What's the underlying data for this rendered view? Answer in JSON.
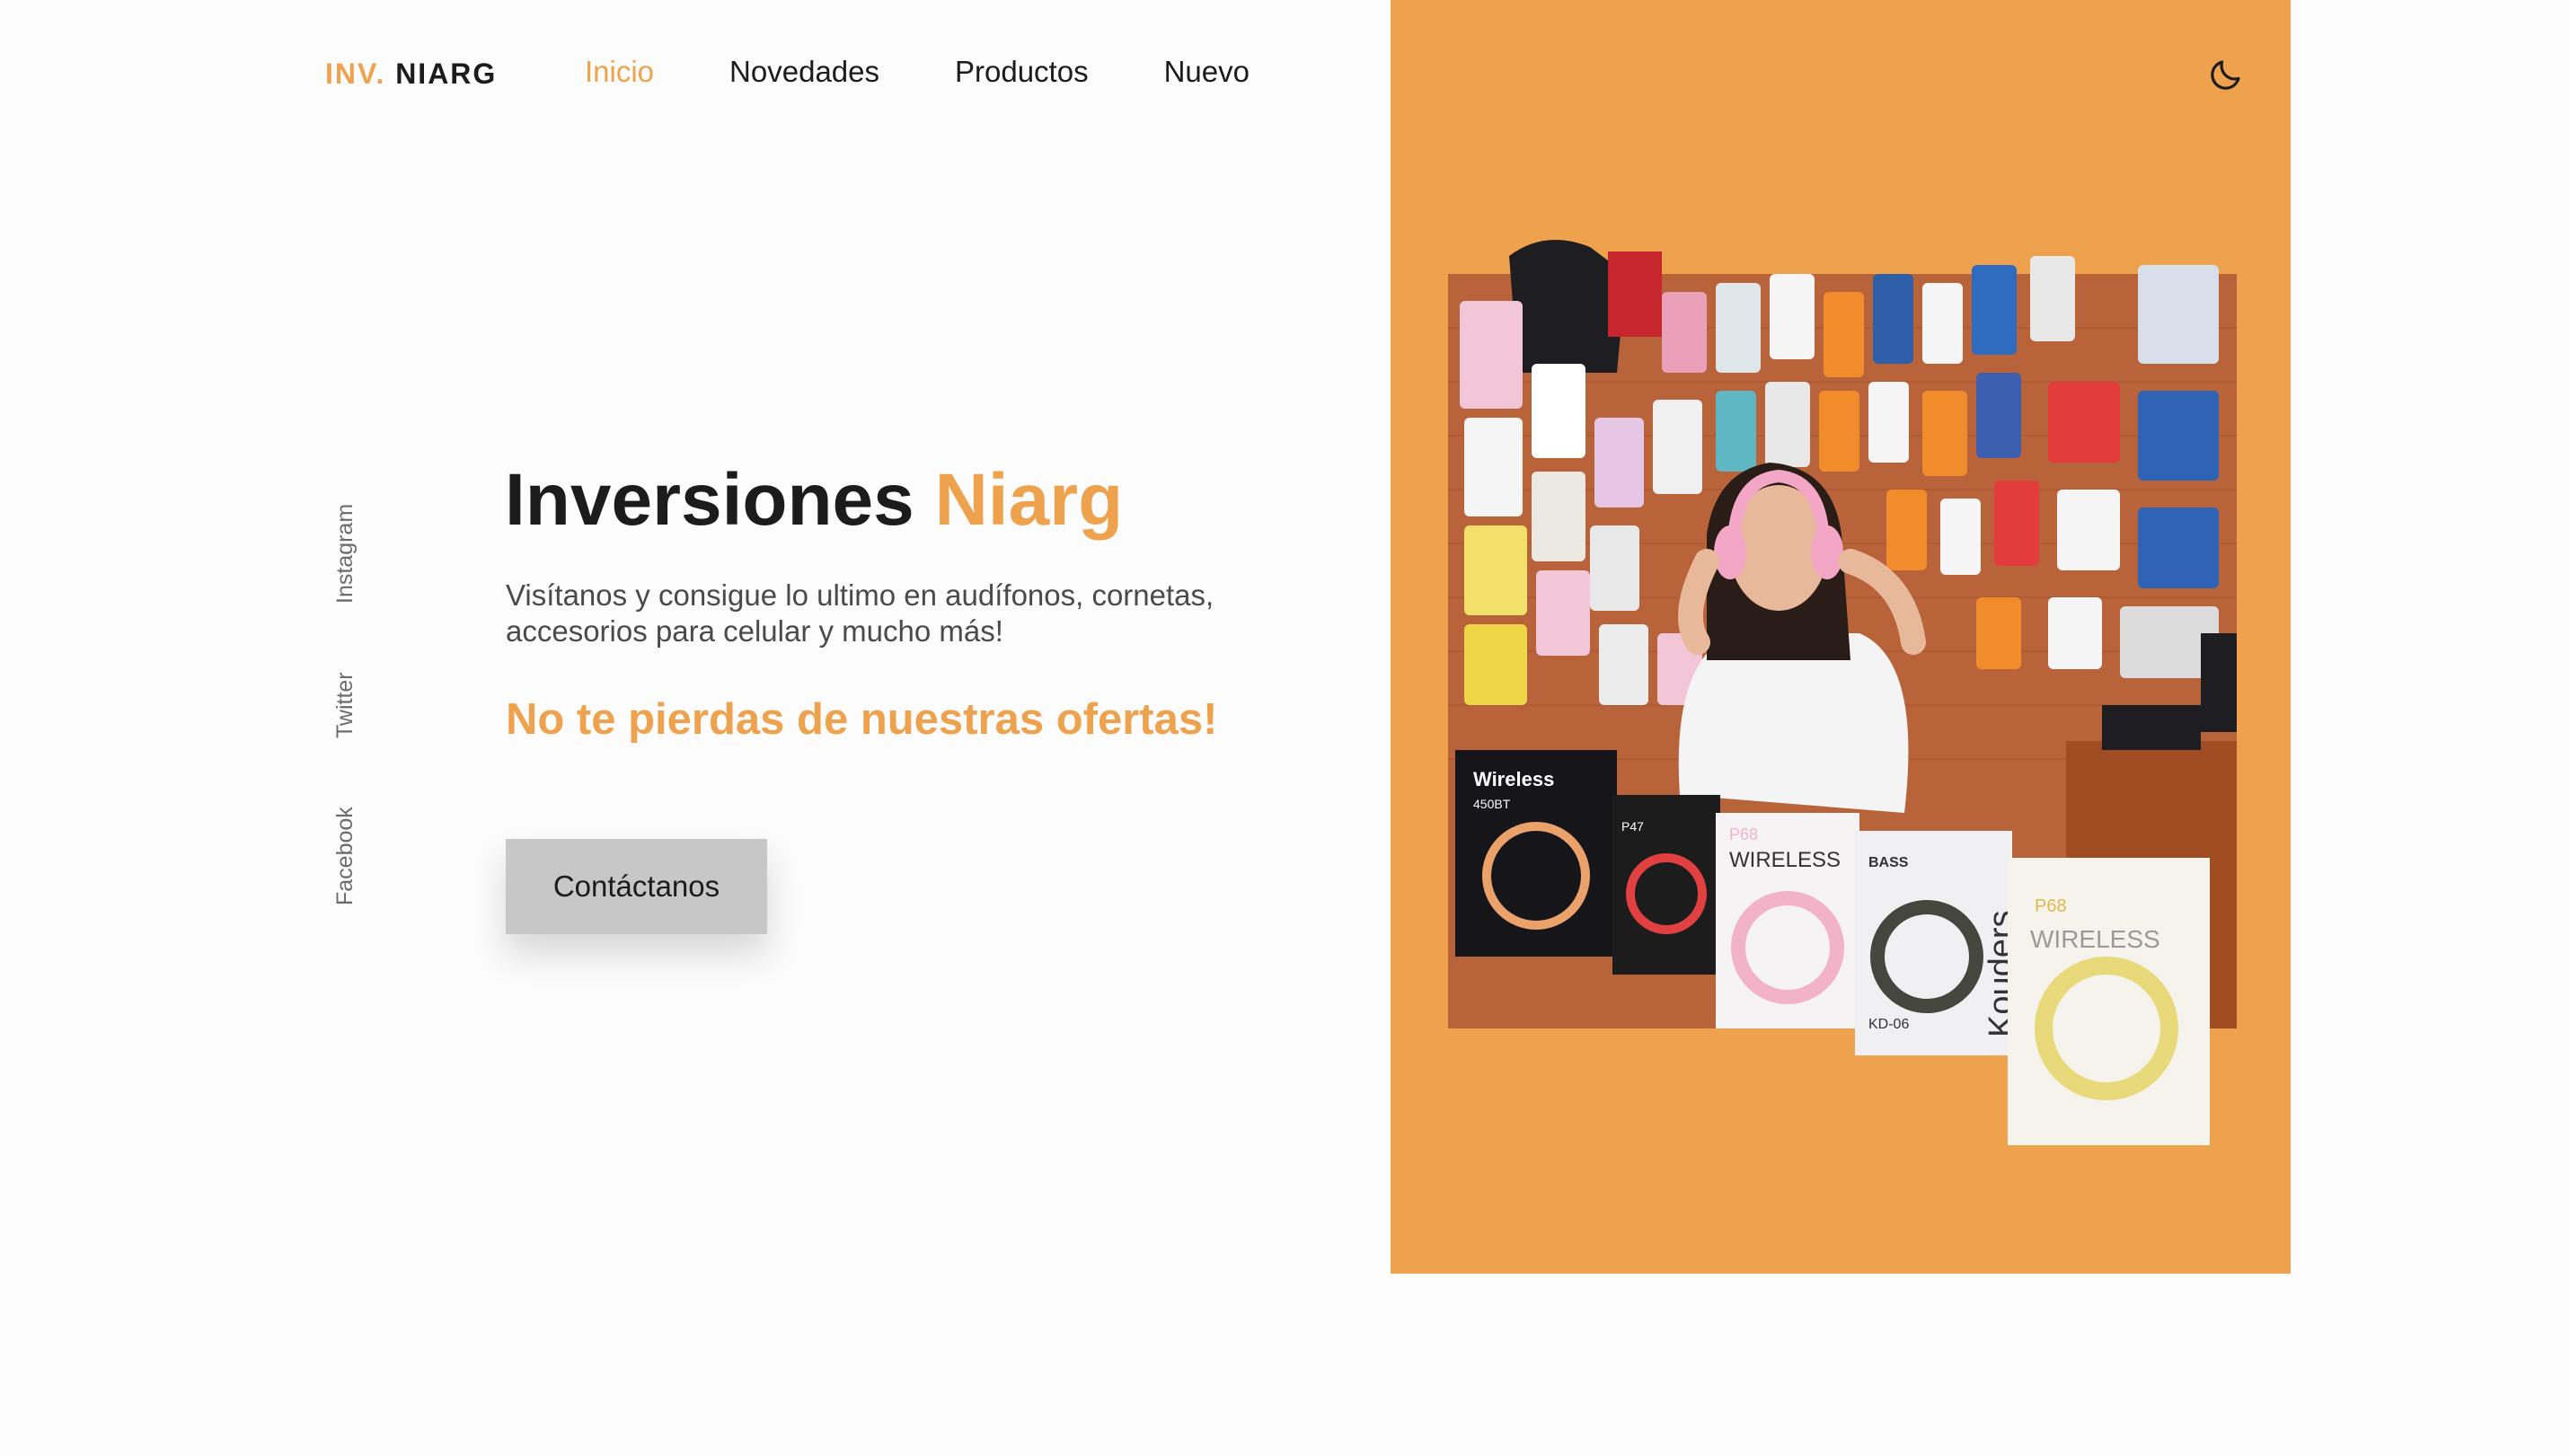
{
  "header": {
    "logo_part1": "INV.",
    "logo_part2": "NIARG",
    "nav": [
      {
        "label": "Inicio",
        "active": true
      },
      {
        "label": "Novedades",
        "active": false
      },
      {
        "label": "Productos",
        "active": false
      },
      {
        "label": "Nuevo",
        "active": false
      }
    ],
    "theme_icon": "moon-icon"
  },
  "social": {
    "instagram": "Instagram",
    "twitter": "Twitter",
    "facebook": "Facebook"
  },
  "hero": {
    "title_main": "Inversiones",
    "title_accent": "Niarg",
    "description": "Visítanos y consigue lo ultimo en audífonos, cornetas, accesorios para celular y mucho más!",
    "promo": "No te pierdas de nuestras ofertas!",
    "cta_label": "Contáctanos"
  },
  "image": {
    "box_labels": [
      "Wireless",
      "450BT",
      "P47",
      "WIRELESS",
      "P68",
      "BASS",
      "KD-06",
      "Kouders",
      "WIRELESS",
      "P68"
    ]
  },
  "colors": {
    "accent": "#eea24d",
    "text_dark": "#1c1c1c",
    "text_muted": "#6b6b6b",
    "button_bg": "#c7c7c7",
    "background": "#fdfcfd"
  }
}
